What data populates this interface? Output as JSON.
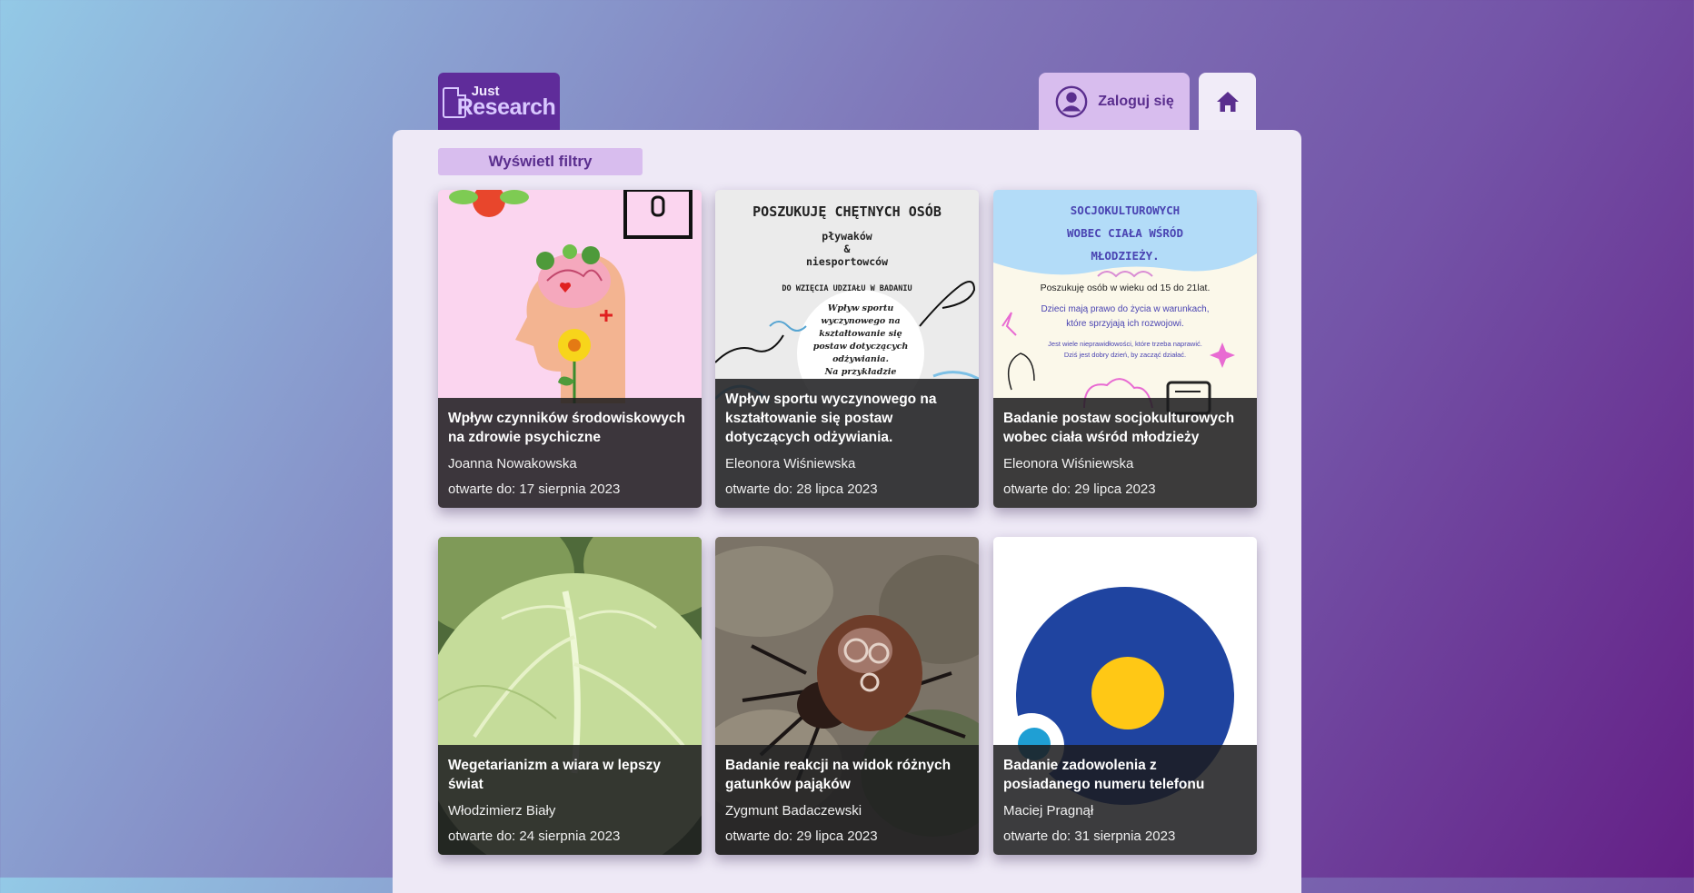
{
  "logo": {
    "line1": "Just",
    "line2": "Research"
  },
  "header": {
    "login_label": "Zaloguj się"
  },
  "filters": {
    "button_label": "Wyświetl filtry"
  },
  "cards": [
    {
      "title": "Wpływ czynników środowiskowych na zdrowie psychiczne",
      "author": "Joanna Nowakowska",
      "deadline": "otwarte do: 17 sierpnia 2023",
      "poster": {}
    },
    {
      "title": "Wpływ sportu wyczynowego na kształtowanie się postaw dotyczących odżywiania.",
      "author": "Eleonora Wiśniewska",
      "deadline": "otwarte do: 28 lipca 2023",
      "poster": {
        "heading": "POSZUKUJĘ CHĘTNYCH OSÓB",
        "line1": "pływaków",
        "line2": "&",
        "line3": "niesportowców",
        "line4": "DO WZIĘCIA UDZIAŁU W BADANIU",
        "circle1": "Wpływ sportu",
        "circle2": "wyczynowego na",
        "circle3": "kształtowanie się",
        "circle4": "postaw dotyczących",
        "circle5": "odżywiania.",
        "circle6": "Na przykładzie"
      }
    },
    {
      "title": "Badanie postaw socjokulturowych wobec ciała wśród młodzieży",
      "author": "Eleonora Wiśniewska",
      "deadline": "otwarte do: 29 lipca 2023",
      "poster": {
        "h1": "SOCJOKULTUROWYCH",
        "h2": "WOBEC CIAŁA WŚRÓD",
        "h3": "MŁODZIEŻY.",
        "t1": "Poszukuję osób w wieku od 15 do 21lat.",
        "t2": "Dzieci mają prawo do życia w warunkach,",
        "t3": "które sprzyjają ich rozwojowi.",
        "t4": "Jest wiele nieprawidłowości, które trzeba naprawić.",
        "t5": "Dziś jest dobry dzień, by zacząć działać."
      }
    },
    {
      "title": "Wegetarianizm a wiara w lepszy świat",
      "author": "Włodzimierz Biały",
      "deadline": "otwarte do: 24 sierpnia 2023",
      "poster": {}
    },
    {
      "title": "Badanie reakcji na widok różnych gatunków pająków",
      "author": "Zygmunt Badaczewski",
      "deadline": "otwarte do: 29 lipca 2023",
      "poster": {}
    },
    {
      "title": "Badanie zadowolenia z posiadanego numeru telefonu",
      "author": "Maciej Pragnął",
      "deadline": "otwarte do: 31 sierpnia 2023",
      "poster": {}
    }
  ]
}
